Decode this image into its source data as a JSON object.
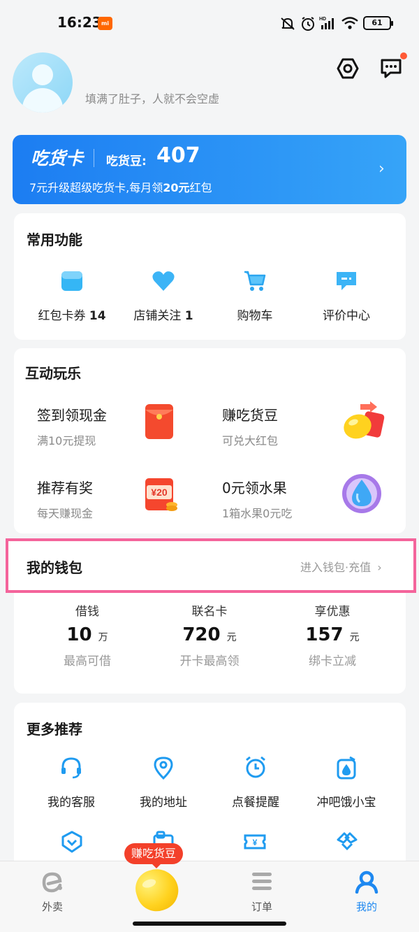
{
  "status_bar": {
    "time": "16:23",
    "carrier_badge": "mi",
    "battery": "61",
    "icons": [
      "mute-bell-icon",
      "alarm-icon",
      "hd-signal-icon",
      "wifi-icon",
      "battery-icon"
    ]
  },
  "header": {
    "motto": "填满了肚子，人就不会空虚",
    "icons": [
      "settings-hexagon-icon",
      "message-icon"
    ]
  },
  "foodie_card": {
    "name": "吃货卡",
    "beans_label": "吃货豆:",
    "beans_value": "407",
    "subtitle_prefix": "7元升级超级吃货卡,每月领",
    "subtitle_highlight": "20元",
    "subtitle_suffix": "红包",
    "colors": {
      "start": "#1c7df2",
      "end": "#36a4f8"
    }
  },
  "common_functions": {
    "title": "常用功能",
    "items": [
      {
        "label": "红包卡券",
        "count": "14",
        "icon": "coupon-icon"
      },
      {
        "label": "店铺关注",
        "count": "1",
        "icon": "heart-icon"
      },
      {
        "label": "购物车",
        "count": "",
        "icon": "cart-icon"
      },
      {
        "label": "评价中心",
        "count": "",
        "icon": "comment-icon"
      }
    ]
  },
  "interactive": {
    "title": "互动玩乐",
    "items": [
      {
        "title": "签到领现金",
        "subtitle": "满10元提现",
        "icon": "red-envelope-icon"
      },
      {
        "title": "赚吃货豆",
        "subtitle": "可兑大红包",
        "icon": "bean-gift-icon"
      },
      {
        "title": "推荐有奖",
        "subtitle": "每天赚现金",
        "icon": "cash-20-icon",
        "icon_text": "¥20"
      },
      {
        "title": "0元领水果",
        "subtitle": "1箱水果0元吃",
        "icon": "water-drop-icon"
      }
    ]
  },
  "wallet": {
    "title": "我的钱包",
    "link": "进入钱包·充值",
    "highlight_color": "#f4649b",
    "items": [
      {
        "label": "借钱",
        "value": "10",
        "unit": "万",
        "subtitle": "最高可借"
      },
      {
        "label": "联名卡",
        "value": "720",
        "unit": "元",
        "subtitle": "开卡最高领"
      },
      {
        "label": "享优惠",
        "value": "157",
        "unit": "元",
        "subtitle": "绑卡立减"
      }
    ]
  },
  "more": {
    "title": "更多推荐",
    "items": [
      {
        "label": "我的客服",
        "icon": "headset-icon"
      },
      {
        "label": "我的地址",
        "icon": "location-pin-icon"
      },
      {
        "label": "点餐提醒",
        "icon": "alarm-clock-icon"
      },
      {
        "label": "冲吧饿小宝",
        "icon": "bottle-icon"
      }
    ],
    "row2_icons": [
      "shield-check-icon",
      "id-card-icon",
      "yuan-ticket-icon",
      "handshake-icon"
    ]
  },
  "tab_bar": {
    "promo_bubble": "赚吃货豆",
    "tabs": [
      {
        "label": "外卖",
        "icon": "eleme-logo-icon",
        "active": false
      },
      {
        "label": "",
        "icon": "bean-icon",
        "active": false
      },
      {
        "label": "订单",
        "icon": "list-icon",
        "active": false
      },
      {
        "label": "我的",
        "icon": "person-icon",
        "active": true
      }
    ],
    "active_color": "#1e88f0"
  }
}
